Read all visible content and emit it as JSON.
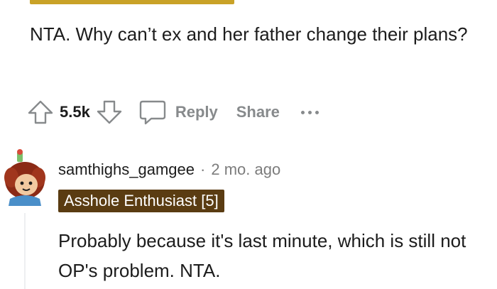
{
  "parent_comment": {
    "body": "NTA. Why can’t ex and her father change their plans?",
    "vote_count": "5.5k",
    "reply_label": "Reply",
    "share_label": "Share",
    "icons": [
      "upvote-icon",
      "downvote-icon",
      "reply-bubble-icon",
      "more-options-icon"
    ]
  },
  "reply_comment": {
    "username": "samthighs_gamgee",
    "separator": "·",
    "timestamp": "2 mo. ago",
    "flair": "Asshole Enthusiast [5]",
    "body": "Probably because it's last minute, which is still not OP's problem. NTA."
  },
  "colors": {
    "flair_background": "#5a3c12",
    "top_flair_background": "#c9a227",
    "muted_text": "#878a8c"
  }
}
